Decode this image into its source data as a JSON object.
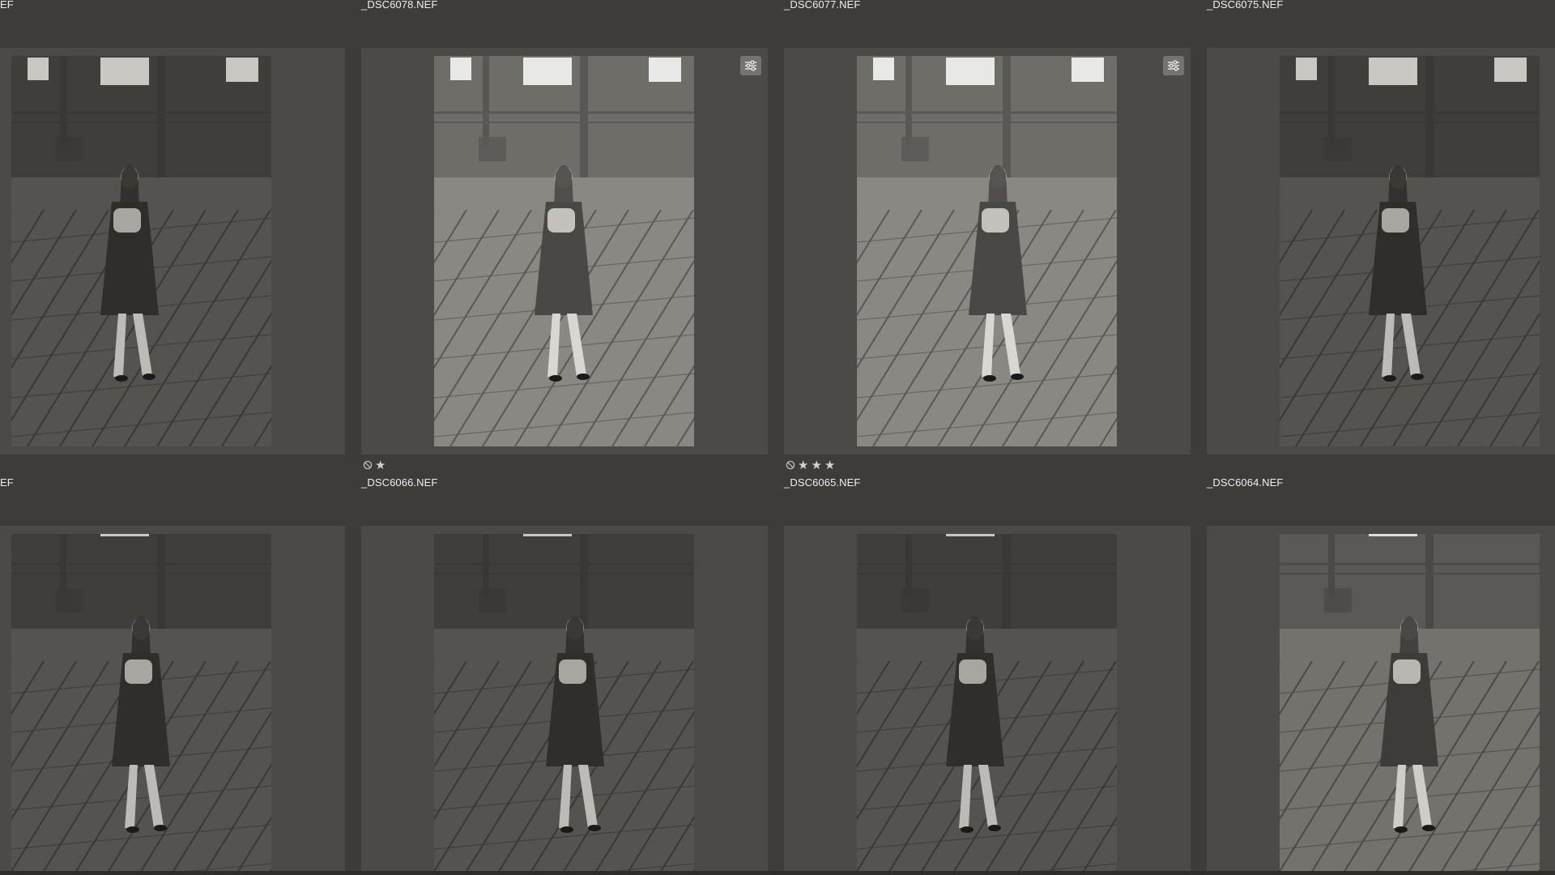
{
  "grid": {
    "captions_top": [
      "EF",
      "_DSC6078.NEF",
      "_DSC6077.NEF",
      "_DSC6075.NEF"
    ],
    "captions_middle": [
      "EF",
      "_DSC6066.NEF",
      "_DSC6065.NEF",
      "_DSC6064.NEF"
    ],
    "row1": [
      {
        "has_adjustments": false,
        "rating": 0,
        "rejected": false,
        "exposure": "dark"
      },
      {
        "has_adjustments": true,
        "rating": 1,
        "rejected": true,
        "exposure": "bright"
      },
      {
        "has_adjustments": true,
        "rating": 3,
        "rejected": true,
        "exposure": "bright"
      },
      {
        "has_adjustments": false,
        "rating": 0,
        "rejected": false,
        "exposure": "dark"
      }
    ],
    "row2": [
      {
        "has_adjustments": false,
        "rating": 0,
        "rejected": false,
        "exposure": "dark"
      },
      {
        "has_adjustments": false,
        "rating": 0,
        "rejected": false,
        "exposure": "dark"
      },
      {
        "has_adjustments": false,
        "rating": 0,
        "rejected": false,
        "exposure": "dark"
      },
      {
        "has_adjustments": false,
        "rating": 0,
        "rejected": false,
        "exposure": "mid"
      }
    ],
    "star_glyph": "★",
    "icons": {
      "reject": "reject-flag-icon",
      "star": "star-icon",
      "adjust": "adjustments-sliders-icon"
    },
    "colors": {
      "background": "#3d3c39",
      "cell": "#4b4a46",
      "caption": "#eeeeec",
      "badge": "#74736e"
    }
  }
}
